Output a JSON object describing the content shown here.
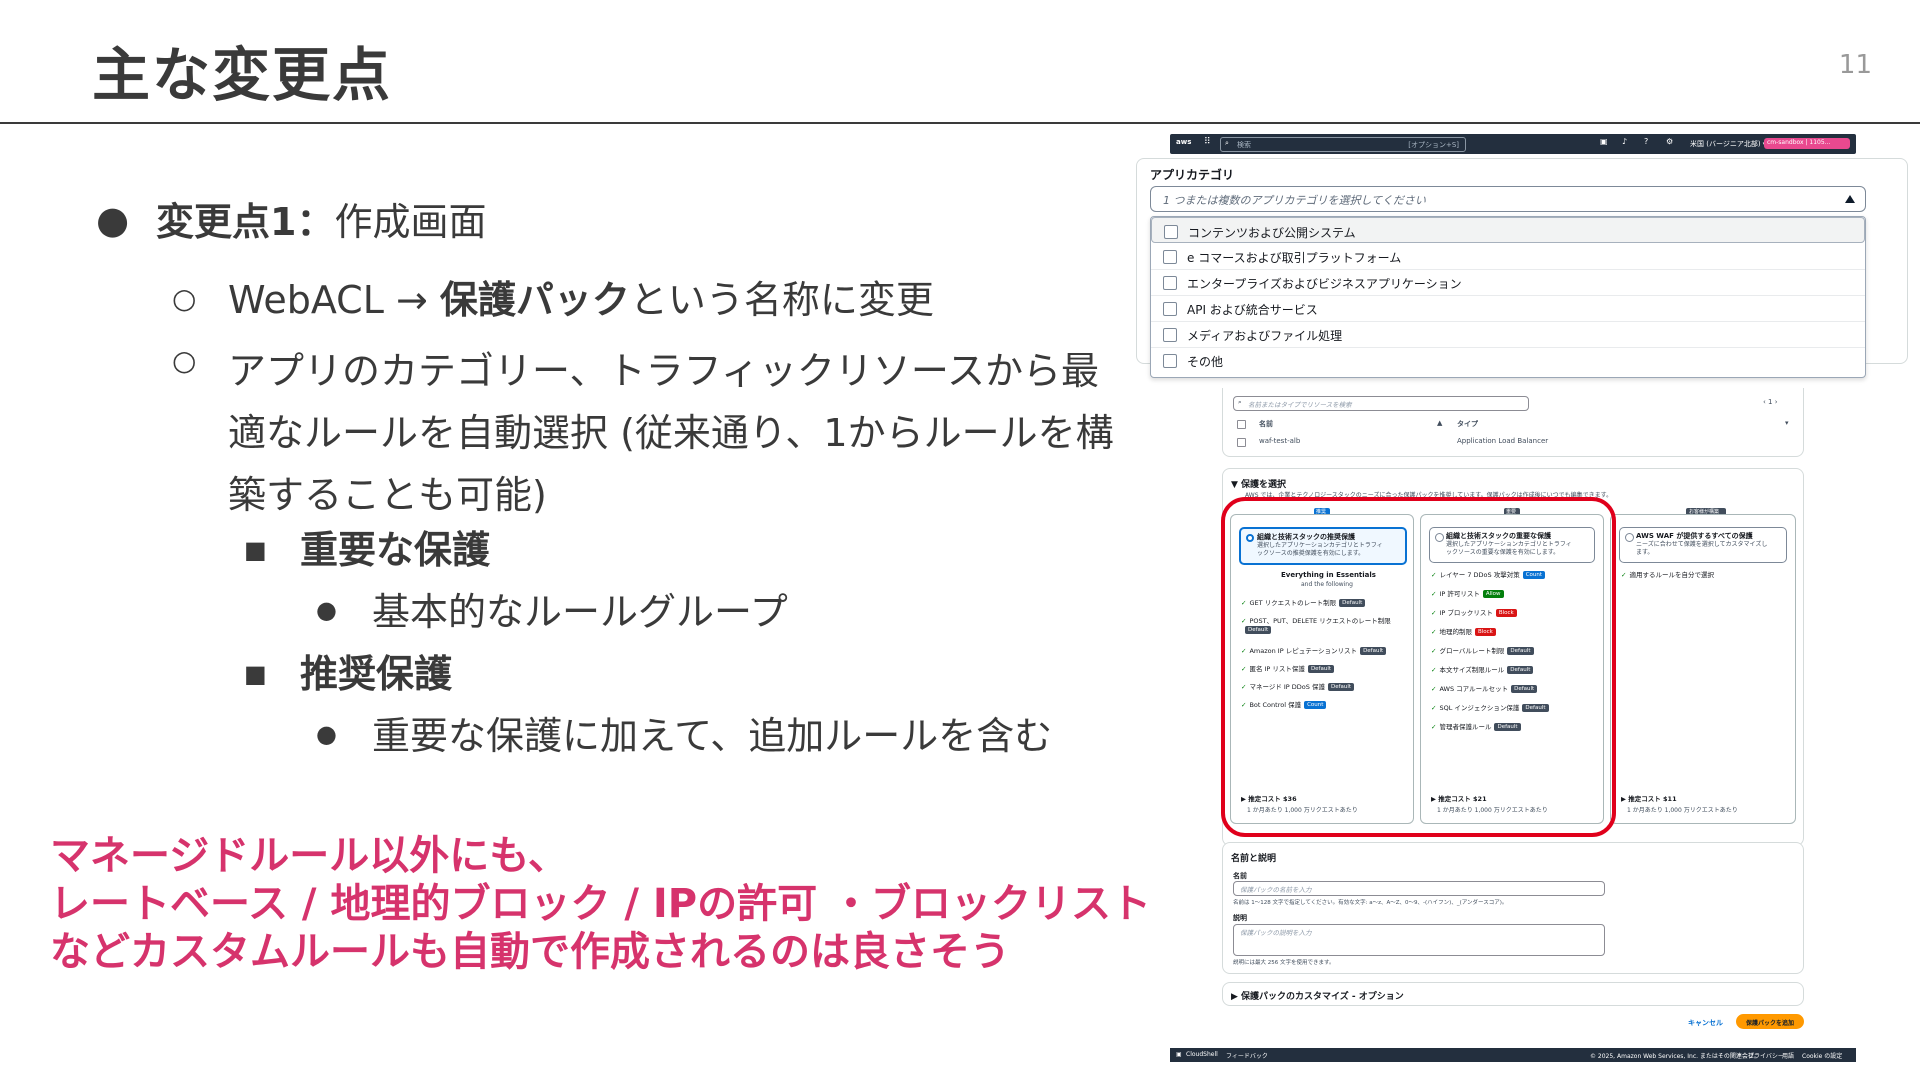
{
  "slide": {
    "title": "主な変更点",
    "page_number": "11"
  },
  "bullets": {
    "b1_bold": "変更点1：",
    "b1_text": "作成画面",
    "b1_1_pre": "WebACL → ",
    "b1_1_bold": "保護パック",
    "b1_1_post": "という名称に変更",
    "b1_2_line1": "アプリのカテゴリー、トラフィックリソースから最",
    "b1_2_line2": "適なルールを自動選択 (従来通り、1からルールを構",
    "b1_2_line3": "築することも可能)",
    "b1_2_1": "重要な保護",
    "b1_2_1_1": "基本的なルールグループ",
    "b1_2_2": "推奨保護",
    "b1_2_2_1": "重要な保護に加えて、追加ルールを含む"
  },
  "note": {
    "line1": "マネージドルール以外にも、",
    "line2": "レートベース / 地理的ブロック / IPの許可 ・ブロックリスト",
    "line3": "などカスタムルールも自動で作成されるのは良さそう"
  },
  "screenshot": {
    "topbar": {
      "search_placeholder": "検索",
      "shortcut": "[オプション+S]",
      "region": "米国 (バージニア北部) ▾",
      "account": "cm-sandbox | 1105..."
    },
    "app_category": {
      "label": "アプリカテゴリ",
      "placeholder": "1 つまたは複数のアプリカテゴリを選択してください",
      "options": [
        "コンテンツおよび公開システム",
        "e コマースおよび取引プラットフォーム",
        "エンタープライズおよびビジネスアプリケーション",
        "API および統合サービス",
        "メディアおよびファイル処理",
        "その他"
      ]
    },
    "resources": {
      "search_placeholder": "名前またはタイプでリソースを検索",
      "pager": "‹ 1 ›",
      "col_name": "名前",
      "col_type": "タイプ",
      "row_name": "waf-test-alb",
      "row_type": "Application Load Balancer"
    },
    "protection": {
      "heading": "▼ 保護を選択",
      "desc": "AWS では、企業とテクノロジースタックのニーズに合った保護パックを推奨しています。保護パックは作成後にいつでも編集できます。",
      "cards": [
        {
          "tag": "推奨",
          "title": "組織と技術スタックの推奨保護",
          "desc1": "選択したアプリケーションカテゴリとトラフィ",
          "desc2": "ックソースの推奨保護を有効にします。",
          "sub1": "Everything in Essentials",
          "sub2": "and the following",
          "rules": [
            {
              "label": "GET リクエストのレート制限",
              "badge": "Default"
            },
            {
              "label": "POST、PUT、DELETE リクエストのレート制限",
              "badge": "Default"
            },
            {
              "label": "Amazon IP レピュテーションリスト",
              "badge": "Default"
            },
            {
              "label": "匿名 IP リスト保護",
              "badge": "Default"
            },
            {
              "label": "マネージド IP DDoS 保護",
              "badge": "Default"
            },
            {
              "label": "Bot Control 保護",
              "badge": "Count"
            }
          ],
          "cost": "▶ 推定コスト $36",
          "cost_sub": "1 か月あたり 1,000 万リクエストあたり"
        },
        {
          "tag": "重要",
          "title": "組織と技術スタックの重要な保護",
          "desc1": "選択したアプリケーションカテゴリとトラフィ",
          "desc2": "ックソースの重要な保護を有効にします。",
          "rules": [
            {
              "label": "レイヤー 7 DDoS 攻撃対策",
              "badge": "Count"
            },
            {
              "label": "IP 許可リスト",
              "badge": "Allow"
            },
            {
              "label": "IP ブロックリスト",
              "badge": "Block"
            },
            {
              "label": "地理的制限",
              "badge": "Block"
            },
            {
              "label": "グローバルレート制限",
              "badge": "Default"
            },
            {
              "label": "本文サイズ制限ルール",
              "badge": "Default"
            },
            {
              "label": "AWS コアルールセット",
              "badge": "Default"
            },
            {
              "label": "SQL インジェクション保護",
              "badge": "Default"
            },
            {
              "label": "管理者保護ルール",
              "badge": "Default"
            }
          ],
          "cost": "▶ 推定コスト $21",
          "cost_sub": "1 か月あたり 1,000 万リクエストあたり"
        },
        {
          "tag": "お客様が構築",
          "title": "AWS WAF が提供するすべての保護",
          "desc1": "ニーズに合わせて保護を選択してカスタマイズし",
          "desc2": "ます。",
          "rules": [
            {
              "label": "適用するルールを自分で選択",
              "badge": ""
            }
          ],
          "cost": "▶ 推定コスト $11",
          "cost_sub": "1 か月あたり 1,000 万リクエストあたり"
        }
      ]
    },
    "name_desc": {
      "heading": "名前と説明",
      "name_label": "名前",
      "name_placeholder": "保護パックの名前を入力",
      "name_hint": "名前は 1～128 文字で指定してください。有効な文字: a～z、A～Z、0～9、-(ハイフン)、_(アンダースコア)。",
      "desc_label": "説明",
      "desc_placeholder": "保護パックの説明を入力",
      "desc_hint": "説明には最大 256 文字を使用できます。"
    },
    "customize": "▶ 保護パックのカスタマイズ - オプション",
    "cancel": "キャンセル",
    "create": "保護パックを追加",
    "footer": {
      "cloudshell": "CloudShell",
      "feedback": "フィードバック",
      "copyright": "© 2025, Amazon Web Services, Inc. またはその関連会社。",
      "privacy": "プライバシー",
      "terms": "用語",
      "cookie": "Cookie の設定"
    }
  }
}
